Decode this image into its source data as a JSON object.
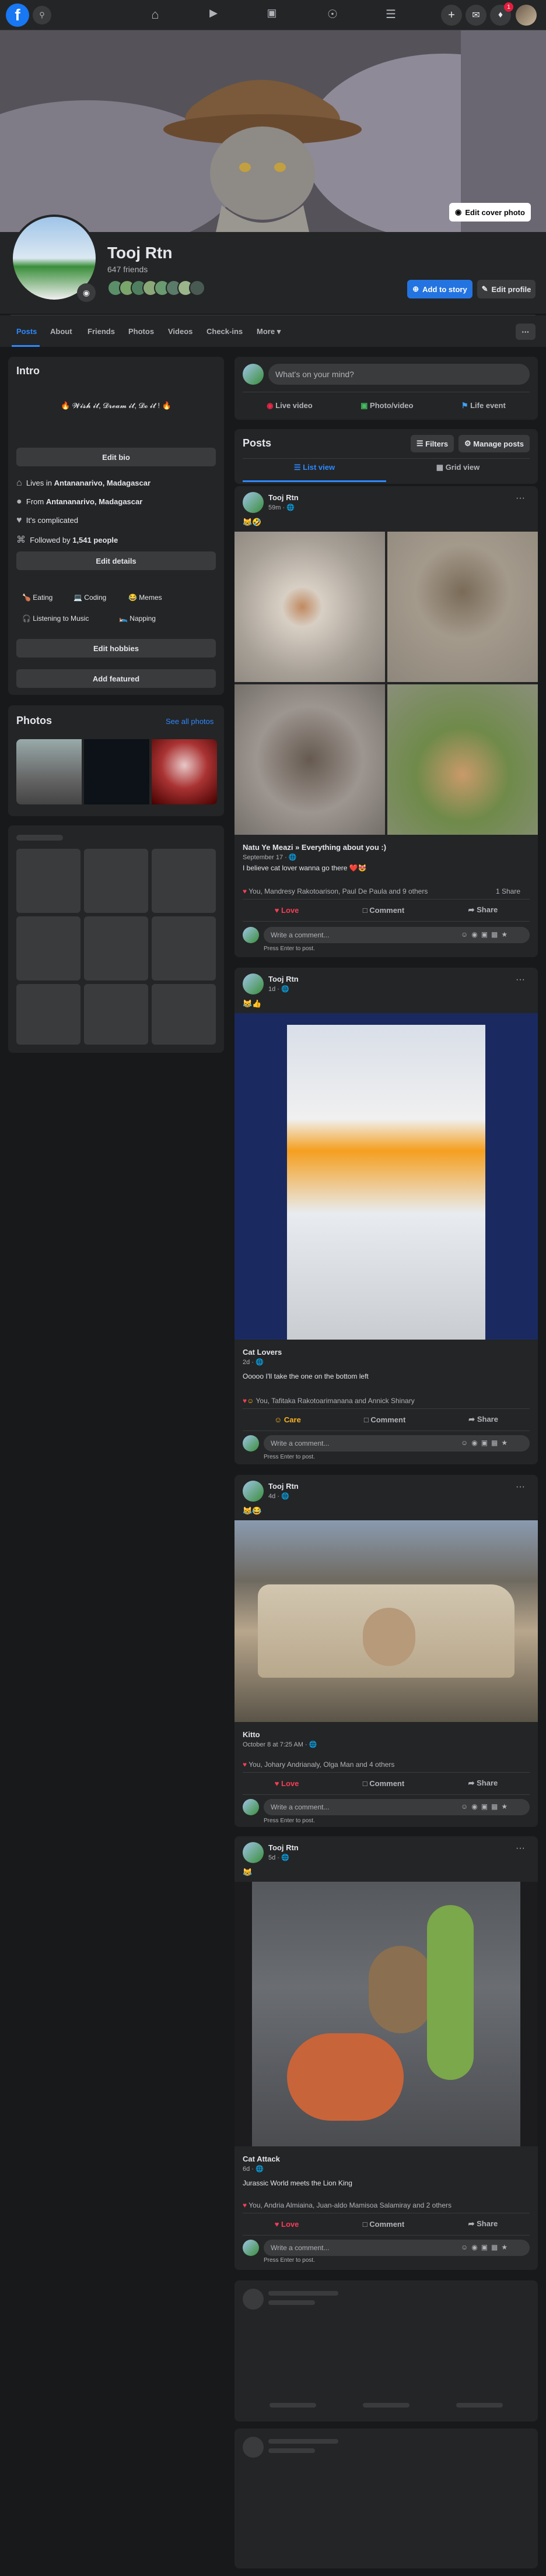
{
  "nav": {
    "icons": [
      "facebook-logo",
      "search-icon",
      "home-icon",
      "watch-icon",
      "marketplace-icon",
      "groups-icon",
      "menu-icon",
      "plus-icon",
      "messenger-icon",
      "bell-icon"
    ],
    "notification_badge": "1"
  },
  "cover": {
    "edit_cover_label": "Edit cover photo"
  },
  "profile": {
    "name": "Tooj Rtn",
    "friends": "647 friends",
    "add_story": "Add to story",
    "edit_profile": "Edit profile"
  },
  "tabs": [
    "Posts",
    "About",
    "Friends",
    "Photos",
    "Videos",
    "Check-ins",
    "More"
  ],
  "intro": {
    "title": "Intro",
    "bio": "🔥 𝓦𝓲𝓼𝓱 𝓲𝓽, 𝓓𝓻𝓮𝓪𝓶 𝓲𝓽, 𝓓𝓸 𝓲𝓽 ! 🔥",
    "edit_bio": "Edit bio",
    "details": [
      {
        "icon": "house-icon",
        "prefix": "Lives in ",
        "bold": "Antananarivo, Madagascar"
      },
      {
        "icon": "location-icon",
        "prefix": "From ",
        "bold": "Antananarivo, Madagascar"
      },
      {
        "icon": "heart-icon",
        "prefix": "It's complicated",
        "bold": ""
      },
      {
        "icon": "rss-icon",
        "prefix": "Followed by ",
        "bold": "1,541 people"
      }
    ],
    "edit_details": "Edit details",
    "hobbies": [
      "🍗 Eating",
      "💻 Coding",
      "😂 Memes",
      "🎧 Listening to Music",
      "🛌 Napping"
    ],
    "edit_hobbies": "Edit hobbies",
    "add_featured": "Add featured"
  },
  "photos": {
    "title": "Photos",
    "see_all": "See all photos"
  },
  "composer": {
    "placeholder": "What's on your mind?",
    "live": "Live video",
    "photo": "Photo/video",
    "event": "Life event"
  },
  "posts_header": {
    "title": "Posts",
    "filters": "Filters",
    "manage": "Manage posts",
    "list_view": "List view",
    "grid_view": "Grid view"
  },
  "posts": [
    {
      "author": "Tooj Rtn",
      "time": "59m · 🌐",
      "text_top": "😹🤣",
      "shared_title": "Natu Ye Meazi » Everything about you :)",
      "shared_date": "September 17 · 🌐",
      "shared_text": "I believe cat lover wanna go there ❤️😻",
      "reactions": "You, Mandresy Rakotoarison, Paul De Paula and 9 others",
      "shares": "1 Share",
      "like_label": "Love",
      "comment_label": "Comment",
      "share_label": "Share",
      "comment_placeholder": "Write a comment...",
      "enter_hint": "Press Enter to post."
    },
    {
      "author": "Tooj Rtn",
      "time": "1d · 🌐",
      "text_top": "😹👍",
      "shared_title": "Cat Lovers",
      "shared_date": "2d · 🌐",
      "shared_text": "Ooooo I'll take the one on the bottom left",
      "reactions": "You, Tafitaka Rakotoarimanana and Annick Shinary",
      "shares": "",
      "like_label": "Care",
      "comment_label": "Comment",
      "share_label": "Share",
      "comment_placeholder": "Write a comment...",
      "enter_hint": "Press Enter to post."
    },
    {
      "author": "Tooj Rtn",
      "time": "4d · 🌐",
      "text_top": "😹😂",
      "shared_title": "Kitto",
      "shared_date": "October 8 at 7:25 AM · 🌐",
      "shared_text": "",
      "reactions": "You, Johary Andrianaly, Olga Man and 4 others",
      "shares": "",
      "like_label": "Love",
      "comment_label": "Comment",
      "share_label": "Share",
      "comment_placeholder": "Write a comment...",
      "enter_hint": "Press Enter to post."
    },
    {
      "author": "Tooj Rtn",
      "time": "5d · 🌐",
      "text_top": "😹",
      "shared_title": "Cat Attack",
      "shared_date": "6d · 🌐",
      "shared_text": "Jurassic World meets the Lion King",
      "reactions": "You, Andria Almiaina, Juan-aldo Mamisoa Salamiray and 2 others",
      "shares": "",
      "like_label": "Love",
      "comment_label": "Comment",
      "share_label": "Share",
      "comment_placeholder": "Write a comment...",
      "enter_hint": "Press Enter to post."
    }
  ],
  "colors": {
    "bg": "#18191a",
    "card": "#242526",
    "accent": "#2374e1",
    "love": "#f33e58",
    "care": "#f7b125"
  }
}
